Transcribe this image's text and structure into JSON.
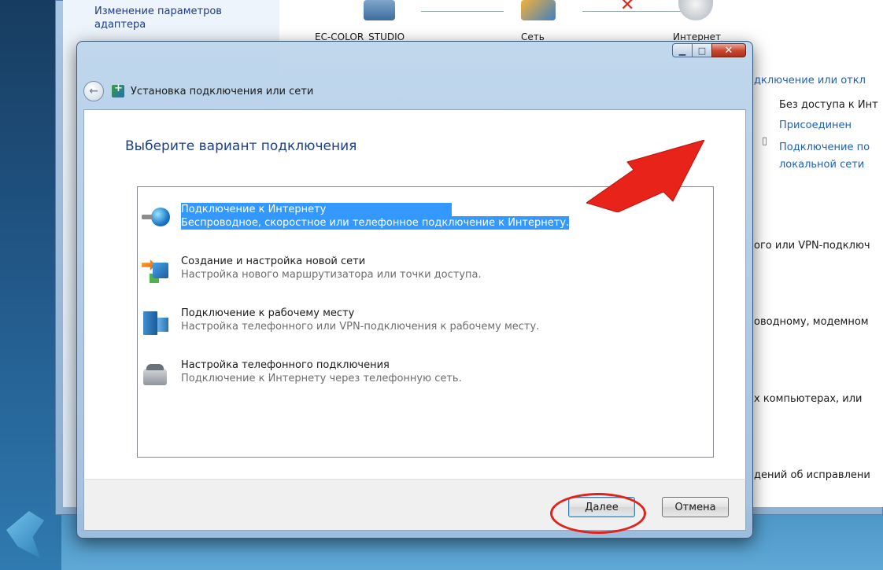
{
  "background": {
    "sidebar_link": "Изменение параметров адаптера",
    "network_map": {
      "computer": "EC-COLOR_STUDIO",
      "network": "Сеть",
      "internet": "Интернет"
    },
    "right_panel": {
      "connection_line": "дключение или откл",
      "no_access": "Без доступа к Инт",
      "connected": "Присоединен",
      "lan_line1": "Подключение по",
      "lan_line2": "локальной сети",
      "vpn_line": "ого или VPN-подключ",
      "wired_line": "оводному, модемном",
      "computers_line": "х компьютерах, или",
      "fixes_line": "дений об исправлени"
    }
  },
  "dialog": {
    "title": "Установка подключения или сети",
    "heading": "Выберите вариант подключения",
    "options": [
      {
        "title": "Подключение к Интернету",
        "description": "Беспроводное, скоростное или телефонное подключение к Интернету.",
        "icon": "globe-icon",
        "selected": true
      },
      {
        "title": "Создание и настройка новой сети",
        "description": "Настройка нового маршрутизатора или точки доступа.",
        "icon": "new-network-icon",
        "selected": false
      },
      {
        "title": "Подключение к рабочему месту",
        "description": "Настройка телефонного или VPN-подключения к рабочему месту.",
        "icon": "workplace-icon",
        "selected": false
      },
      {
        "title": "Настройка телефонного подключения",
        "description": "Подключение к Интернету через телефонную сеть.",
        "icon": "dialup-phone-icon",
        "selected": false
      }
    ],
    "buttons": {
      "next": "Далее",
      "cancel": "Отмена"
    }
  },
  "colors": {
    "selection": "#3399ff",
    "heading": "#1c3f8c",
    "annotation": "#e0241a"
  }
}
